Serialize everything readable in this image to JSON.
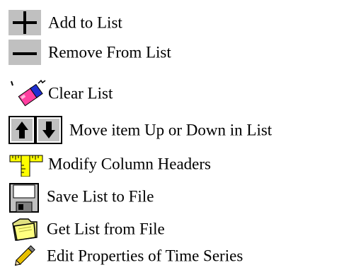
{
  "legend": {
    "items": [
      {
        "icon": "plus-icon",
        "label": "Add to List"
      },
      {
        "icon": "minus-icon",
        "label": "Remove From List"
      },
      {
        "icon": "eraser-icon",
        "label": "Clear List"
      },
      {
        "icon": "up-down-arrows-icon",
        "label": "Move item Up or Down in List"
      },
      {
        "icon": "ruler-icon",
        "label": "Modify Column Headers"
      },
      {
        "icon": "floppy-disk-icon",
        "label": "Save List to File"
      },
      {
        "icon": "folder-icon",
        "label": "Get List from File"
      },
      {
        "icon": "pencil-icon",
        "label": "Edit Properties of Time Series"
      }
    ]
  },
  "colors": {
    "button_face": "#c0c0c0",
    "eraser_pink": "#ff3fa0",
    "eraser_blue": "#1f2fd0",
    "ruler_yellow": "#ffff00",
    "folder_yellow": "#ffff80",
    "pencil_yellow": "#e8c000"
  }
}
